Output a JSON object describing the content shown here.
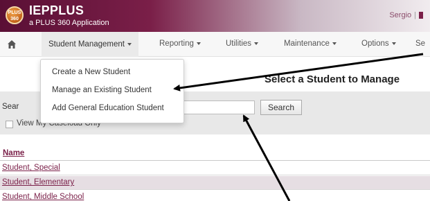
{
  "app": {
    "logo_text": "PLUS 360",
    "title": "IEPPLUS",
    "subtitle": "a PLUS 360 Application",
    "user_name": "Sergio",
    "separator": "|"
  },
  "nav": {
    "items": [
      {
        "label": "Student Management"
      },
      {
        "label": "Reporting"
      },
      {
        "label": "Utilities"
      },
      {
        "label": "Maintenance"
      },
      {
        "label": "Options"
      },
      {
        "label": "Se"
      }
    ]
  },
  "dropdown": {
    "items": [
      {
        "label": "Create a New Student"
      },
      {
        "label": "Manage an Existing Student"
      },
      {
        "label": "Add General Education Student"
      }
    ]
  },
  "main": {
    "heading": "Select a Student to Manage",
    "search_label": "Sear",
    "search_value": "",
    "search_button": "Search",
    "caseload_label": "View My Caseload Only",
    "caseload_checked": false
  },
  "table": {
    "column_header": "Name",
    "rows": [
      {
        "name": "Student, Special"
      },
      {
        "name": "Student, Elementary"
      },
      {
        "name": "Student, Middle School"
      }
    ]
  },
  "colors": {
    "brand": "#7a1f48",
    "link": "#7a1f48",
    "alt_row": "#e6dee3"
  }
}
